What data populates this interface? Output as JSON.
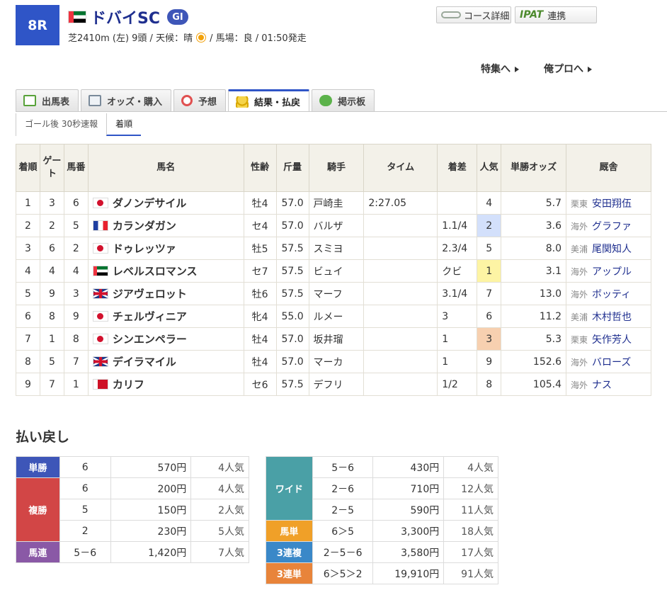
{
  "race": {
    "number": "8R",
    "name": "ドバイSC",
    "grade": "GI",
    "info_prefix": "芝2410m (左) 9頭 / 天候：晴",
    "info_suffix": "/ 馬場：良 / 01:50発走"
  },
  "header_buttons": {
    "course": "コース詳細",
    "ipat_logo": "IPAT",
    "ipat": "連携"
  },
  "links": {
    "feature": "特集へ",
    "orepro": "俺プロへ"
  },
  "tabs": [
    "出馬表",
    "オッズ・購入",
    "予想",
    "結果・払戻",
    "掲示板"
  ],
  "subtabs": [
    "ゴール後 30秒速報",
    "着順"
  ],
  "table": {
    "headers": [
      "着順",
      "ゲート",
      "馬番",
      "馬名",
      "性齢",
      "斤量",
      "騎手",
      "タイム",
      "着差",
      "人気",
      "単勝オッズ",
      "厩舎"
    ],
    "rows": [
      {
        "pos": "1",
        "gate": "3",
        "num": "6",
        "flag": "jpn",
        "name": "ダノンデサイル",
        "sex": "牡4",
        "wt": "57.0",
        "jockey": "戸崎圭",
        "time": "2:27.05",
        "margin": "",
        "pop": "4",
        "odds": "5.7",
        "hi": true,
        "area": "栗東",
        "trainer": "安田翔伍"
      },
      {
        "pos": "2",
        "gate": "2",
        "num": "5",
        "flag": "fra",
        "name": "カランダガン",
        "sex": "セ4",
        "wt": "57.0",
        "jockey": "バルザ",
        "time": "",
        "margin": "1.1/4",
        "pop": "2",
        "odds": "3.6",
        "hi": true,
        "area": "海外",
        "trainer": "グラファ"
      },
      {
        "pos": "3",
        "gate": "6",
        "num": "2",
        "flag": "jpn",
        "name": "ドゥレッツァ",
        "sex": "牡5",
        "wt": "57.5",
        "jockey": "スミヨ",
        "time": "",
        "margin": "2.3/4",
        "pop": "5",
        "odds": "8.0",
        "hi": true,
        "area": "美浦",
        "trainer": "尾関知人"
      },
      {
        "pos": "4",
        "gate": "4",
        "num": "4",
        "flag": "uae",
        "name": "レベルスロマンス",
        "sex": "セ7",
        "wt": "57.5",
        "jockey": "ビュイ",
        "time": "",
        "margin": "クビ",
        "pop": "1",
        "odds": "3.1",
        "hi": true,
        "area": "海外",
        "trainer": "アップル"
      },
      {
        "pos": "5",
        "gate": "9",
        "num": "3",
        "flag": "gbr",
        "name": "ジアヴェロット",
        "sex": "牡6",
        "wt": "57.5",
        "jockey": "マーフ",
        "time": "",
        "margin": "3.1/4",
        "pop": "7",
        "odds": "13.0",
        "hi": false,
        "area": "海外",
        "trainer": "ボッティ"
      },
      {
        "pos": "6",
        "gate": "8",
        "num": "9",
        "flag": "jpn",
        "name": "チェルヴィニア",
        "sex": "牝4",
        "wt": "55.0",
        "jockey": "ルメー",
        "time": "",
        "margin": "3",
        "pop": "6",
        "odds": "11.2",
        "hi": false,
        "area": "美浦",
        "trainer": "木村哲也"
      },
      {
        "pos": "7",
        "gate": "1",
        "num": "8",
        "flag": "jpn",
        "name": "シンエンペラー",
        "sex": "牡4",
        "wt": "57.0",
        "jockey": "坂井瑠",
        "time": "",
        "margin": "1",
        "pop": "3",
        "odds": "5.3",
        "hi": true,
        "area": "栗東",
        "trainer": "矢作芳人"
      },
      {
        "pos": "8",
        "gate": "5",
        "num": "7",
        "flag": "gbr",
        "name": "デイラマイル",
        "sex": "牡4",
        "wt": "57.0",
        "jockey": "マーカ",
        "time": "",
        "margin": "1",
        "pop": "9",
        "odds": "152.6",
        "hi": false,
        "area": "海外",
        "trainer": "バローズ"
      },
      {
        "pos": "9",
        "gate": "7",
        "num": "1",
        "flag": "bhr",
        "name": "カリフ",
        "sex": "セ6",
        "wt": "57.5",
        "jockey": "デフリ",
        "time": "",
        "margin": "1/2",
        "pop": "8",
        "odds": "105.4",
        "hi": false,
        "area": "海外",
        "trainer": "ナス"
      }
    ]
  },
  "payout": {
    "heading": "払い戻し",
    "left": [
      {
        "type": "単勝",
        "cls": "lb-tansho",
        "entries": [
          {
            "combo": "6",
            "yen": "570円",
            "pop": "4人気"
          }
        ]
      },
      {
        "type": "複勝",
        "cls": "lb-fukusho",
        "entries": [
          {
            "combo": "6",
            "yen": "200円",
            "pop": "4人気"
          },
          {
            "combo": "5",
            "yen": "150円",
            "pop": "2人気"
          },
          {
            "combo": "2",
            "yen": "230円",
            "pop": "5人気"
          }
        ]
      },
      {
        "type": "馬連",
        "cls": "lb-umaren",
        "entries": [
          {
            "combo": "5－6",
            "yen": "1,420円",
            "pop": "7人気"
          }
        ]
      }
    ],
    "right": [
      {
        "type": "ワイド",
        "cls": "lb-wide",
        "entries": [
          {
            "combo": "5－6",
            "yen": "430円",
            "pop": "4人気"
          },
          {
            "combo": "2－6",
            "yen": "710円",
            "pop": "12人気"
          },
          {
            "combo": "2－5",
            "yen": "590円",
            "pop": "11人気"
          }
        ]
      },
      {
        "type": "馬単",
        "cls": "lb-umatan",
        "entries": [
          {
            "combo": "6＞5",
            "yen": "3,300円",
            "pop": "18人気"
          }
        ]
      },
      {
        "type": "3連複",
        "cls": "lb-3fuku",
        "entries": [
          {
            "combo": "2－5－6",
            "yen": "3,580円",
            "pop": "17人気"
          }
        ]
      },
      {
        "type": "3連単",
        "cls": "lb-3tan",
        "entries": [
          {
            "combo": "6＞5＞2",
            "yen": "19,910円",
            "pop": "91人気"
          }
        ]
      }
    ]
  }
}
